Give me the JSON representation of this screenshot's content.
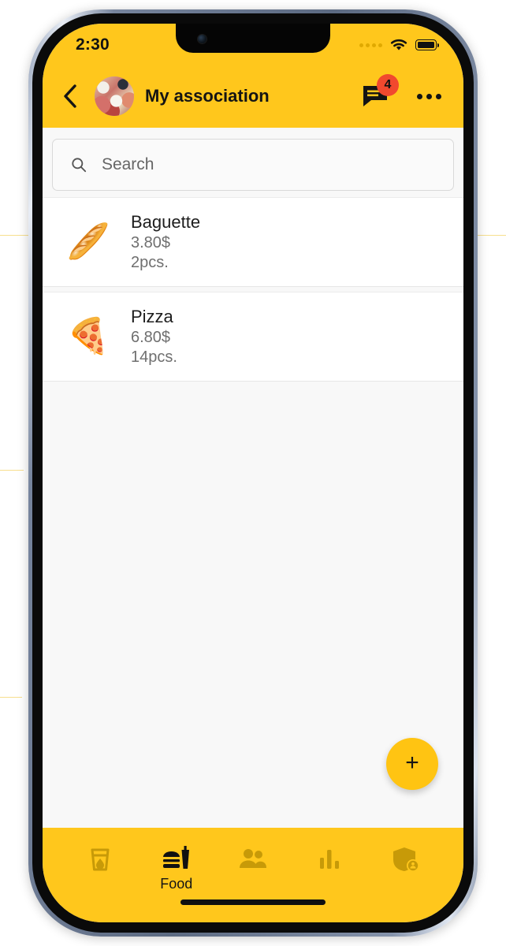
{
  "colors": {
    "brand_yellow": "#FFC71C",
    "fab_yellow": "#FFC412",
    "badge_red": "#F1492E",
    "nav_inactive": "#C79A08",
    "content_bg": "#f8f8f8",
    "card_bg": "#ffffff"
  },
  "status_bar": {
    "time": "2:30",
    "signal_icon": "signal-dots-icon",
    "wifi_icon": "wifi-icon",
    "battery_icon": "battery-full-icon"
  },
  "app_bar": {
    "back_icon": "chevron-left-icon",
    "avatar_name": "group-avatar",
    "title": "My association",
    "chat_icon": "chat-bubble-icon",
    "chat_badge_count": "4",
    "overflow_icon": "more-horizontal-icon"
  },
  "search": {
    "icon": "search-icon",
    "placeholder": "Search",
    "value": ""
  },
  "list": {
    "items": [
      {
        "icon": "baguette-emoji",
        "emoji": "🥖",
        "name": "Baguette",
        "price": "3.80$",
        "quantity": "2pcs."
      },
      {
        "icon": "pizza-emoji",
        "emoji": "🍕",
        "name": "Pizza",
        "price": "6.80$",
        "quantity": "14pcs."
      }
    ]
  },
  "fab": {
    "icon": "plus-icon",
    "label": "+"
  },
  "bottom_nav": {
    "items": [
      {
        "icon": "drink-cup-icon",
        "label": "",
        "active": false
      },
      {
        "icon": "fast-food-icon",
        "label": "Food",
        "active": true
      },
      {
        "icon": "people-icon",
        "label": "",
        "active": false
      },
      {
        "icon": "bar-chart-icon",
        "label": "",
        "active": false
      },
      {
        "icon": "shield-person-icon",
        "label": "",
        "active": false
      }
    ]
  },
  "home_indicator": "home-indicator-bar"
}
